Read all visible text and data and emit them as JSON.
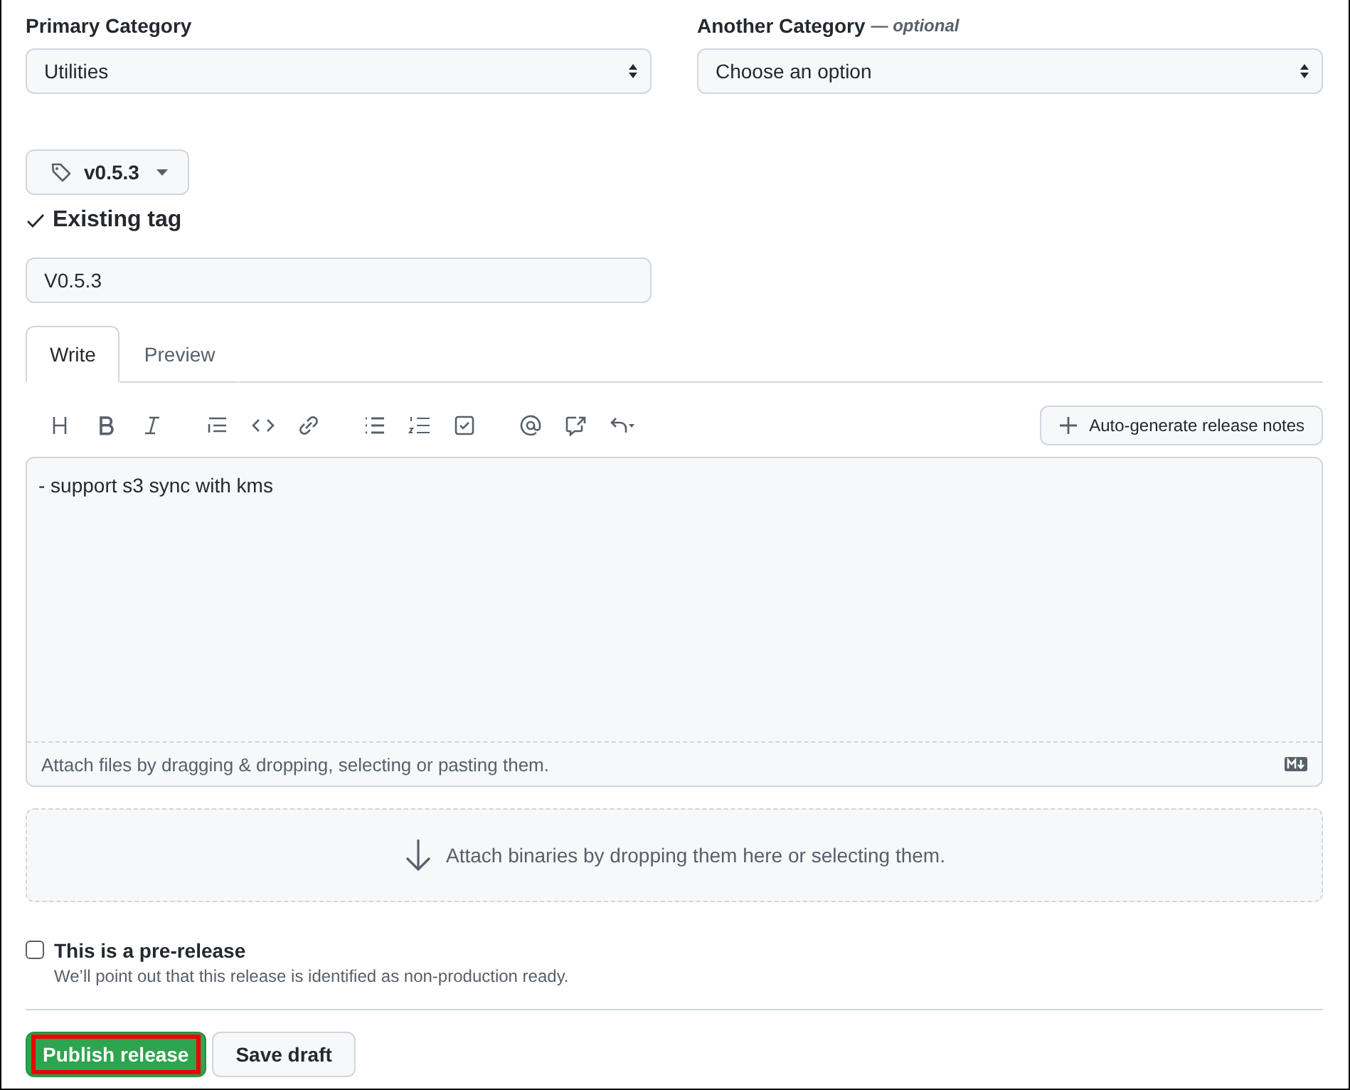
{
  "categories": [
    {
      "label": "Primary Category",
      "value": "Utilities"
    },
    {
      "label": "Another Category",
      "hint": "— optional",
      "value": "Choose an option"
    }
  ],
  "tag": {
    "button": "v0.5.3",
    "status": "Existing tag"
  },
  "title_field": {
    "value": "V0.5.3"
  },
  "tabs": [
    {
      "label": "Write",
      "selected": true
    },
    {
      "label": "Preview",
      "selected": false
    }
  ],
  "toolbar": [
    [
      {
        "kind": "heading"
      },
      {
        "kind": "bold"
      },
      {
        "kind": "italic"
      }
    ],
    [
      {
        "kind": "quote"
      },
      {
        "kind": "code"
      },
      {
        "kind": "link"
      }
    ],
    [
      {
        "kind": "bullets"
      },
      {
        "kind": "numbers"
      },
      {
        "kind": "tasks"
      }
    ],
    [
      {
        "kind": "mention"
      },
      {
        "kind": "reference"
      },
      {
        "kind": "undo"
      }
    ]
  ],
  "autogen_button": "Auto-generate release notes",
  "body": {
    "value": "- support s3 sync with kms",
    "footer": "Attach files by dragging & dropping, selecting or pasting them."
  },
  "binaries": "Attach binaries by dropping them here or selecting them.",
  "prerelease": {
    "label": "This is a pre-release",
    "checked": false,
    "note": "We’ll point out that this release is identified as non-production ready."
  },
  "buttons": [
    {
      "label": "Publish release",
      "kind": "primary",
      "highlighted": true
    },
    {
      "label": "Save draft",
      "kind": "secondary",
      "highlighted": false
    }
  ]
}
